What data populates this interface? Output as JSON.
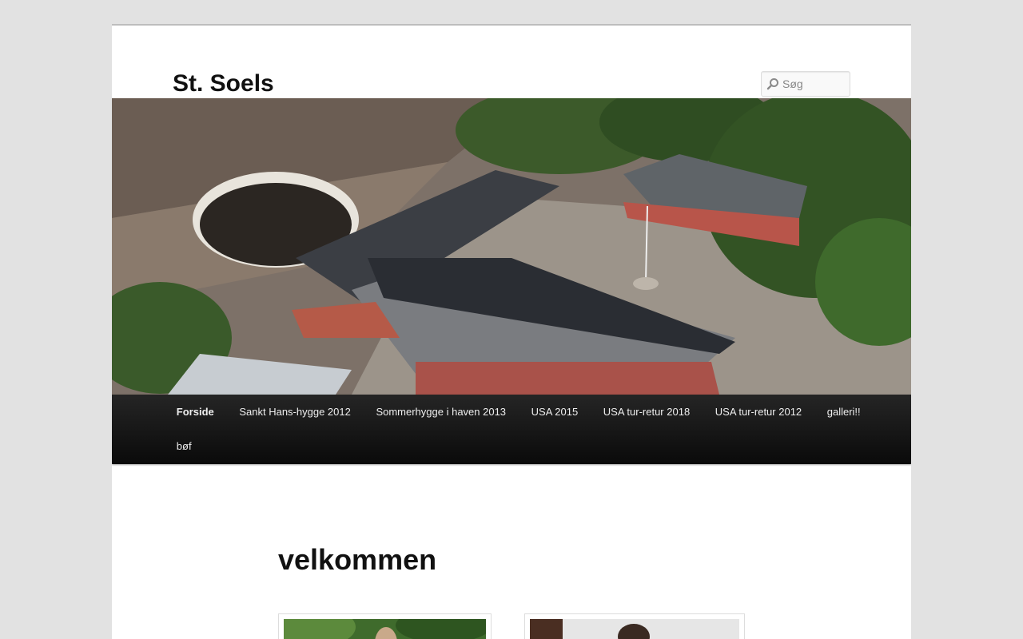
{
  "site": {
    "title": "St. Soels"
  },
  "search": {
    "placeholder": "Søg",
    "icon": "search-icon"
  },
  "colors": {
    "background": "#e2e2e2",
    "page": "#ffffff",
    "nav_background": "#1a1a1a",
    "nav_text": "#eeeeee",
    "title_text": "#111111"
  },
  "nav": {
    "items": [
      {
        "label": "Forside",
        "current": true
      },
      {
        "label": "Sankt Hans-hygge 2012"
      },
      {
        "label": "Sommerhygge i haven 2013"
      },
      {
        "label": "USA 2015"
      },
      {
        "label": "USA tur-retur 2018"
      },
      {
        "label": "USA tur-retur 2012"
      },
      {
        "label": "galleri!!"
      },
      {
        "label": "bøf"
      }
    ]
  },
  "main": {
    "title": "velkommen"
  }
}
